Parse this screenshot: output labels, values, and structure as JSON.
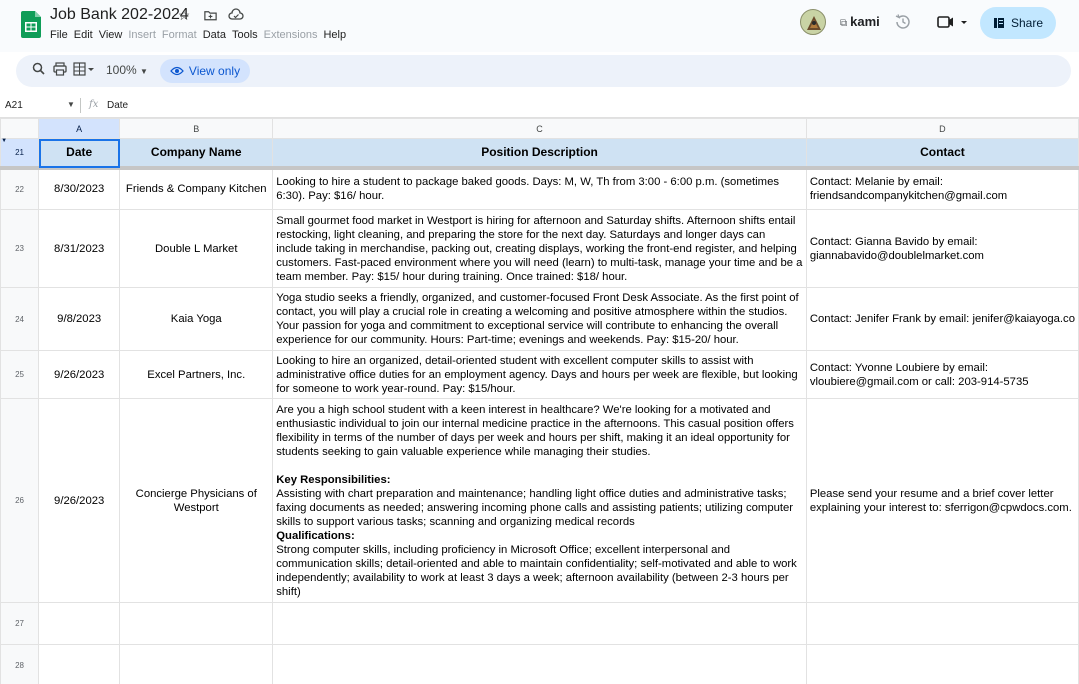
{
  "window": {
    "doc_title": "Job Bank 202-2024",
    "menus": [
      {
        "label": "File",
        "enabled": true
      },
      {
        "label": "Edit",
        "enabled": true
      },
      {
        "label": "View",
        "enabled": true
      },
      {
        "label": "Insert",
        "enabled": false
      },
      {
        "label": "Format",
        "enabled": false
      },
      {
        "label": "Data",
        "enabled": true
      },
      {
        "label": "Tools",
        "enabled": true
      },
      {
        "label": "Extensions",
        "enabled": false
      },
      {
        "label": "Help",
        "enabled": true
      }
    ],
    "kami_label": "kami",
    "share_label": "Share",
    "accent": "#c2e7ff",
    "sheets_green": "#0f9d58"
  },
  "toolbar": {
    "zoom": "100%",
    "view_only_label": "View only"
  },
  "formula_bar": {
    "cell_ref": "A21",
    "fx_label": "fx",
    "value": "Date"
  },
  "grid": {
    "columns": [
      "A",
      "B",
      "C",
      "D"
    ],
    "selected_column": "A",
    "header_row_number": "21",
    "headers": {
      "date": "Date",
      "company": "Company Name",
      "description": "Position Description",
      "contact": "Contact"
    },
    "header_fill": "#cfe2f3",
    "rows": [
      {
        "num": "22",
        "date": "8/30/2023",
        "company": "Friends & Company Kitchen",
        "description": "Looking to hire a student to package baked goods. Days: M, W, Th from 3:00 - 6:00 p.m. (sometimes 6:30). Pay: $16/ hour.",
        "contact": "Contact: Melanie by email: friendsandcompanykitchen@gmail.com"
      },
      {
        "num": "23",
        "date": "8/31/2023",
        "company": "Double L Market",
        "description": "Small gourmet food market in Westport is hiring for afternoon and Saturday shifts. Afternoon shifts entail restocking, light cleaning, and preparing the store for the next day. Saturdays and longer days can include taking in merchandise, packing out, creating displays, working the front-end register, and helping customers. Fast-paced environment where you will need (learn) to multi-task, manage your time and be a team member. Pay: $15/ hour during training. Once trained: $18/ hour.",
        "contact": "Contact: Gianna Bavido by email: giannabavido@doublelmarket.com"
      },
      {
        "num": "24",
        "date": "9/8/2023",
        "company": "Kaia Yoga",
        "description": "Yoga studio seeks a friendly, organized, and customer-focused Front Desk Associate. As the first point of contact, you will play a crucial role in creating a welcoming and positive atmosphere within the studios. Your passion for yoga and commitment to exceptional service will contribute to enhancing the overall experience for our community. Hours: Part-time; evenings and weekends. Pay: $15-20/ hour.",
        "contact": "Contact: Jenifer Frank by email: jenifer@kaiayoga.co"
      },
      {
        "num": "25",
        "date": "9/26/2023",
        "company": "Excel Partners, Inc.",
        "description": "Looking to hire an organized, detail-oriented student with excellent computer skills to assist with administrative office duties for an employment agency. Days and hours per week are flexible, but looking for someone to work year-round. Pay: $15/hour.",
        "contact": "Contact: Yvonne Loubiere by email: vloubiere@gmail.com or call: 203-914-5735"
      },
      {
        "num": "26",
        "date": "9/26/2023",
        "company": "Concierge Physicians of Westport",
        "description_intro": "Are you a high school student with a keen interest in healthcare? We're looking for a motivated and enthusiastic individual to join our internal medicine practice in the afternoons. This casual position offers flexibility in terms of the number of days per week and hours per shift, making it an ideal opportunity for students seeking to gain valuable experience while managing their studies.",
        "resp_heading": "Key Responsibilities:",
        "resp_text": "Assisting with chart preparation and maintenance; handling light office duties and administrative tasks; faxing documents as needed; answering incoming phone calls and assisting patients; utilizing computer skills to support various tasks; scanning and organizing medical records",
        "qual_heading": "Qualifications:",
        "qual_text": "Strong computer skills, including proficiency in Microsoft Office; excellent interpersonal and communication skills; detail-oriented and able to maintain confidentiality; self-motivated and able to work independently; availability to work at least 3 days a week; afternoon availability (between 2-3 hours per shift)",
        "contact": "Please send your resume and a brief cover letter explaining your interest to: sferrigon@cpwdocs.com."
      },
      {
        "num": "27"
      },
      {
        "num": "28"
      }
    ]
  }
}
